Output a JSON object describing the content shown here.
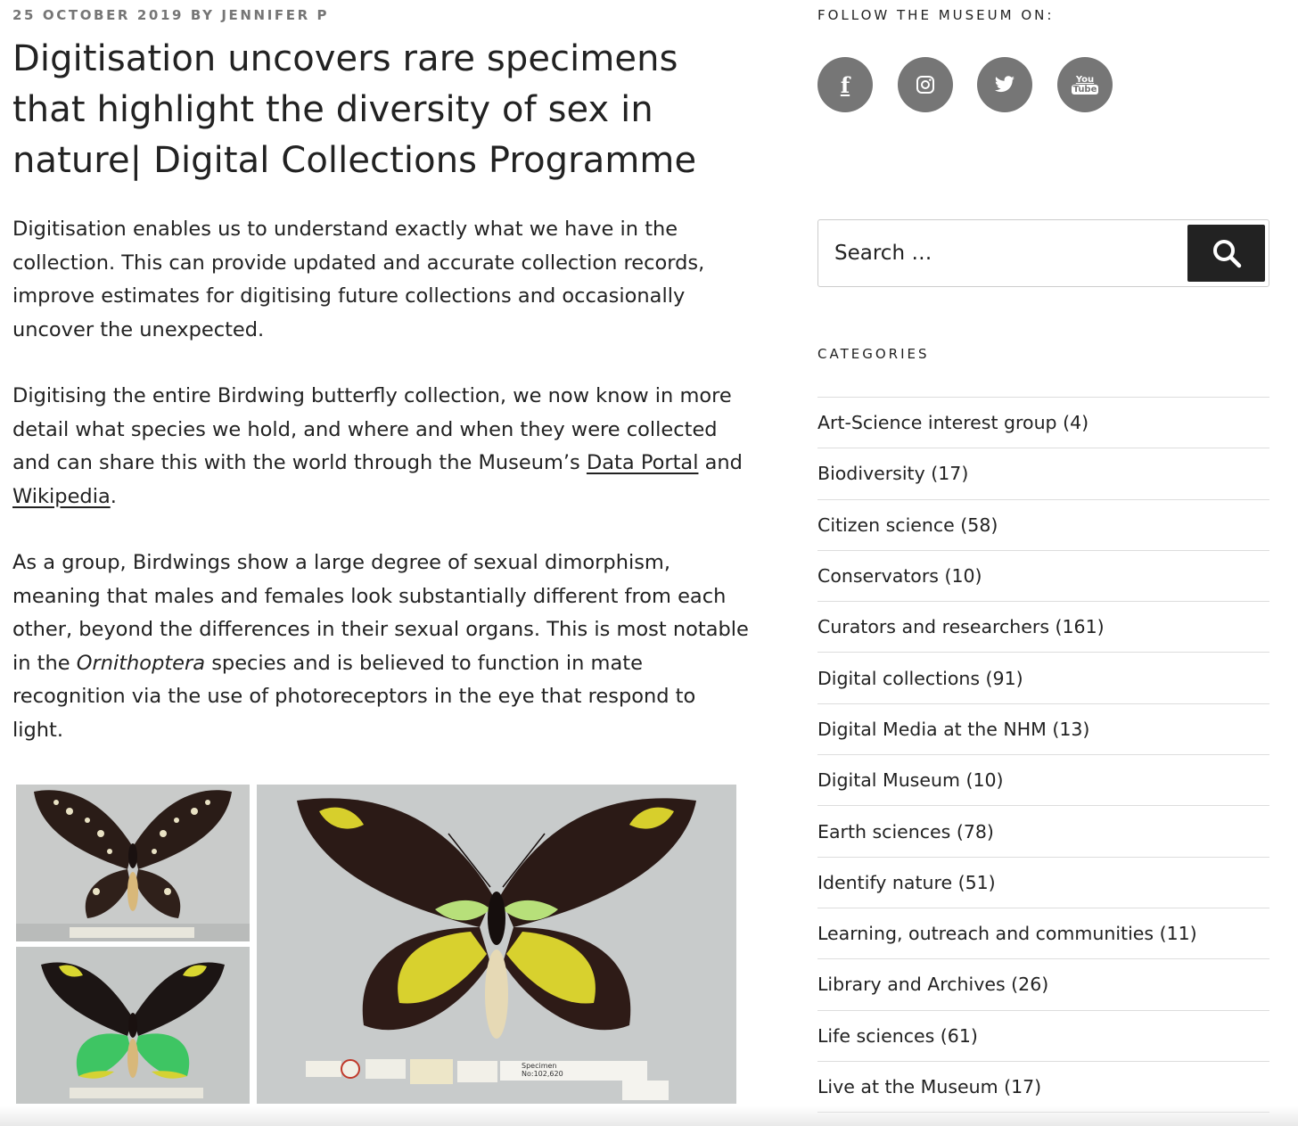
{
  "post": {
    "meta": "25 October 2019 by Jennifer P",
    "title": "Digitisation uncovers rare specimens that highlight the diversity of sex in nature| Digital Collections Programme",
    "p1": "Digitisation enables us to understand exactly what we have in the collection. This can provide updated and accurate collection records, improve estimates for digitising future collections and occasionally uncover the unexpected.",
    "p2_before": "Digitising the entire Birdwing butterfly collection, we now know in more detail what species we hold, and where and when they were collected and can share this with the world through the Museum’s ",
    "p2_link1": "Data Portal",
    "p2_mid": " and ",
    "p2_link2": "Wikipedia",
    "p2_end": ".",
    "p3_before": "As a group, Birdwings show a large degree of sexual dimorphism, meaning that males and females look substantially different from each other, beyond the differences in their sexual organs. This is most notable in the ",
    "p3_em": "Ornithoptera",
    "p3_after": " species and is believed to function in mate recognition via the use of photoreceptors in the eye that respond to light."
  },
  "sidebar": {
    "follow_heading": "Follow the Museum on:",
    "social": [
      {
        "icon": "facebook-icon",
        "glyph": "f"
      },
      {
        "icon": "instagram-icon"
      },
      {
        "icon": "twitter-icon"
      },
      {
        "icon": "youtube-icon",
        "glyph_top": "You",
        "glyph_bottom": "Tube"
      }
    ],
    "search_placeholder": "Search …",
    "categories_heading": "Categories",
    "categories": [
      "Art-Science interest group (4)",
      "Biodiversity (17)",
      "Citizen science (58)",
      "Conservators (10)",
      "Curators and researchers (161)",
      "Digital collections (91)",
      "Digital Media at the NHM (13)",
      "Digital Museum (10)",
      "Earth sciences (78)",
      "Identify nature (51)",
      "Learning, outreach and communities (11)",
      "Library and Archives (26)",
      "Life sciences (61)",
      "Live at the Museum (17)"
    ]
  },
  "specimen_label": {
    "line1": "Specimen",
    "line2": "No:102,620"
  },
  "colors": {
    "social_bg": "#767676",
    "search_button": "#222222",
    "text": "#222222",
    "meta": "#767676"
  }
}
